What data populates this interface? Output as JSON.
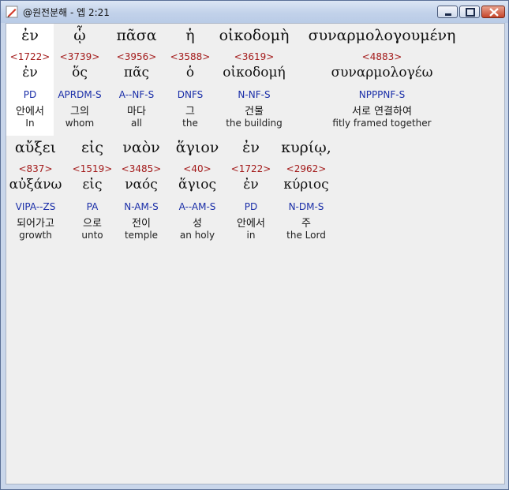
{
  "window": {
    "title": "@원전분해 - 엡 2:21"
  },
  "icons": {
    "app": "pen-quill-icon",
    "minimize": "minimize-icon",
    "maximize": "maximize-icon",
    "close": "close-icon"
  },
  "colors": {
    "strong": "#a31a1a",
    "morph": "#1a2ea8",
    "text": "#111111"
  },
  "verse": {
    "rows": [
      {
        "words": [
          {
            "greek": "ἐν",
            "strong": "<1722>",
            "lemma": "ἐν",
            "morph": "PD",
            "korean": "안에서",
            "english": "In",
            "selected": true
          },
          {
            "greek": "ᾧ",
            "strong": "<3739>",
            "lemma": "ὅς",
            "morph": "APRDM-S",
            "korean": "그의",
            "english": "whom",
            "selected": false
          },
          {
            "greek": "πᾶσα",
            "strong": "<3956>",
            "lemma": "πᾶς",
            "morph": "A--NF-S",
            "korean": "마다",
            "english": "all",
            "selected": false
          },
          {
            "greek": "ἡ",
            "strong": "<3588>",
            "lemma": "ὁ",
            "morph": "DNFS",
            "korean": "그",
            "english": "the",
            "selected": false
          },
          {
            "greek": "οἰκοδομὴ",
            "strong": "<3619>",
            "lemma": "οἰκοδομή",
            "morph": "N-NF-S",
            "korean": "건물",
            "english": "the building",
            "selected": false
          },
          {
            "greek": "συναρμολογουμένη",
            "strong": "<4883>",
            "lemma": "συναρμολογέω",
            "morph": "NPPPNF-S",
            "korean": "서로 연결하여",
            "english": "fitly framed together",
            "selected": false
          }
        ]
      },
      {
        "words": [
          {
            "greek": "αὔξει",
            "strong": "<837>",
            "lemma": "αὐξάνω",
            "morph": "VIPA--ZS",
            "korean": "되어가고",
            "english": "growth",
            "selected": false
          },
          {
            "greek": "εἰς",
            "strong": "<1519>",
            "lemma": "εἰς",
            "morph": "PA",
            "korean": "으로",
            "english": "unto",
            "selected": false
          },
          {
            "greek": "ναὸν",
            "strong": "<3485>",
            "lemma": "ναός",
            "morph": "N-AM-S",
            "korean": "전이",
            "english": "temple",
            "selected": false
          },
          {
            "greek": "ἅγιον",
            "strong": "<40>",
            "lemma": "ἅγιος",
            "morph": "A--AM-S",
            "korean": "성",
            "english": "an holy",
            "selected": false
          },
          {
            "greek": "ἐν",
            "strong": "<1722>",
            "lemma": "ἐν",
            "morph": "PD",
            "korean": "안에서",
            "english": "in",
            "selected": false
          },
          {
            "greek": "κυρίῳ,",
            "strong": "<2962>",
            "lemma": "κύριος",
            "morph": "N-DM-S",
            "korean": "주",
            "english": "the Lord",
            "selected": false
          }
        ]
      }
    ]
  }
}
